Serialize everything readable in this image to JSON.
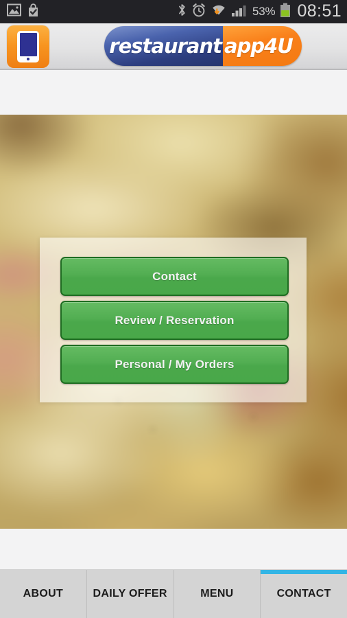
{
  "status_bar": {
    "icons_left": [
      "gallery-icon",
      "play-store-bag-check-icon"
    ],
    "icons_right": [
      "bluetooth-icon",
      "alarm-clock-icon",
      "wifi-download-icon",
      "signal-bars-icon"
    ],
    "battery_percent": "53%",
    "clock": "08:51",
    "battery_level": 53,
    "background_color": "#222226",
    "text_color": "#d8d8d8"
  },
  "app_header": {
    "app_icon_name": "restaurant-app-icon",
    "logo": {
      "left_text": "restaurant",
      "right_text": "app4U",
      "left_color": "#2d3e80",
      "right_color": "#f7801a"
    }
  },
  "hero": {
    "image_name": "blurred-food-photo",
    "alt": "blurred close-up photo of a cheesy baked dish with bacon"
  },
  "menu_panel": {
    "buttons": [
      {
        "label": "Contact",
        "name": "contact-button"
      },
      {
        "label": "Review / Reservation",
        "name": "review-reservation-button"
      },
      {
        "label": "Personal / My Orders",
        "name": "personal-my-orders-button"
      }
    ],
    "button_color": "#4ca84c",
    "button_border_color": "#1f6d22"
  },
  "tab_bar": {
    "active_index": 3,
    "accent_color": "#33b5e5",
    "tabs": [
      {
        "label": "ABOUT",
        "name": "tab-about"
      },
      {
        "label": "DAILY OFFER",
        "name": "tab-daily-offer"
      },
      {
        "label": "MENU",
        "name": "tab-menu"
      },
      {
        "label": "CONTACT",
        "name": "tab-contact"
      }
    ]
  }
}
